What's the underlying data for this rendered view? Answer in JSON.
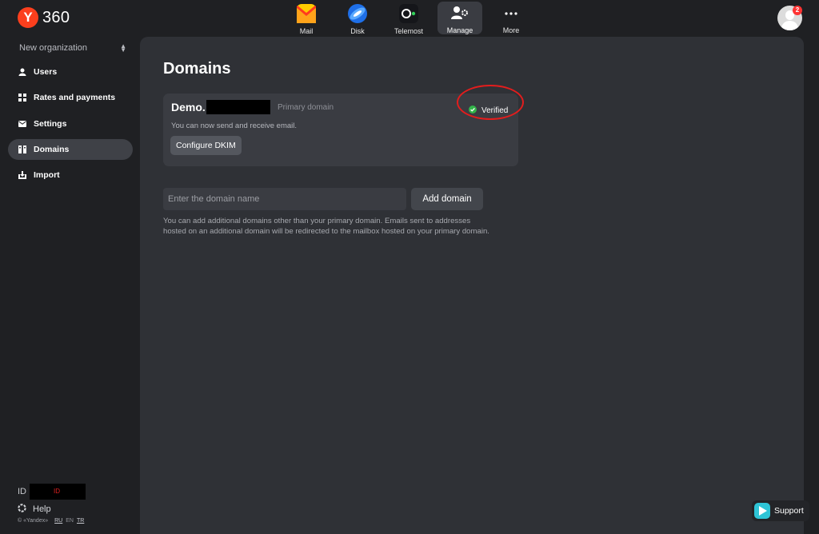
{
  "brand": {
    "badge": "Y",
    "name": "360"
  },
  "apps": [
    {
      "label": "Mail",
      "icon": "mail-icon"
    },
    {
      "label": "Disk",
      "icon": "disk-icon"
    },
    {
      "label": "Telemost",
      "icon": "telemost-icon"
    },
    {
      "label": "Manage",
      "icon": "manage-icon",
      "active": true
    },
    {
      "label": "More",
      "icon": "more-dots-icon"
    }
  ],
  "avatar": {
    "badge_count": "2"
  },
  "sidebar": {
    "org": "New organization",
    "items": [
      {
        "label": "Users",
        "icon": "user-icon"
      },
      {
        "label": "Rates and payments",
        "icon": "grid-icon"
      },
      {
        "label": "Settings",
        "icon": "envelope-icon"
      },
      {
        "label": "Domains",
        "icon": "domains-icon",
        "active": true
      },
      {
        "label": "Import",
        "icon": "import-icon"
      }
    ],
    "id_label": "ID",
    "id_value": "ID",
    "help": "Help",
    "copyright": "© «Yandex»",
    "languages": [
      "RU",
      "EN",
      "TR"
    ]
  },
  "main": {
    "title": "Domains",
    "domain": {
      "name": "Demo.",
      "tag": "Primary domain",
      "status": "Verified",
      "status_color": "#33b54a",
      "note": "You can now send and receive email.",
      "dkim_button": "Configure DKIM"
    },
    "input_placeholder": "Enter the domain name",
    "add_button": "Add domain",
    "help_text": "You can add additional domains other than your primary domain. Emails sent to addresses hosted on an additional domain will be redirected to the mailbox hosted on your primary domain."
  },
  "support": {
    "label": "Support"
  },
  "colors": {
    "brand": "#fc3f1d",
    "highlight": "#e21d1d",
    "panel": "#2f3136",
    "background": "#1f2023"
  }
}
